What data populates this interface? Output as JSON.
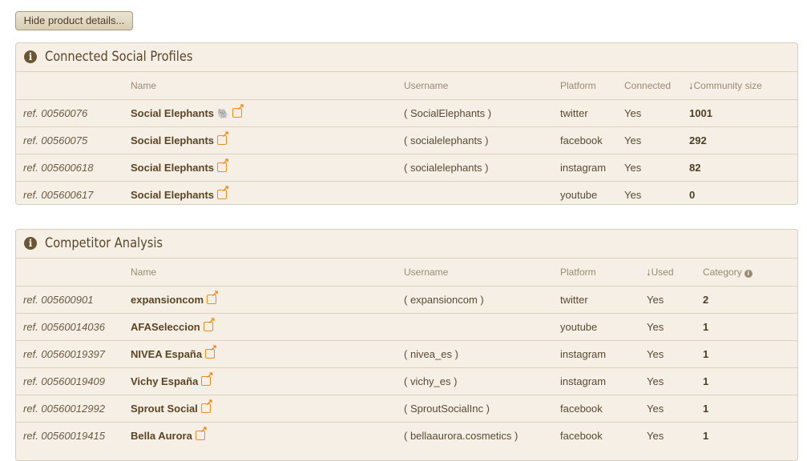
{
  "toggle_button": "Hide product details...",
  "social": {
    "title": "Connected Social Profiles",
    "headers": {
      "name": "Name",
      "username": "Username",
      "platform": "Platform",
      "connected": "Connected",
      "community": "Community size"
    },
    "sort_arrow": "↓",
    "rows": [
      {
        "ref": "ref. 00560076",
        "name": "Social Elephants",
        "emoji": "🐘",
        "username": "( SocialElephants )",
        "platform": "twitter",
        "connected": "Yes",
        "size": "1001"
      },
      {
        "ref": "ref. 00560075",
        "name": "Social Elephants",
        "emoji": "",
        "username": "( socialelephants )",
        "platform": "facebook",
        "connected": "Yes",
        "size": "292"
      },
      {
        "ref": "ref. 005600618",
        "name": "Social Elephants",
        "emoji": "",
        "username": "( socialelephants )",
        "platform": "instagram",
        "connected": "Yes",
        "size": "82"
      },
      {
        "ref": "ref. 005600617",
        "name": "Social Elephants",
        "emoji": "",
        "username": "",
        "platform": "youtube",
        "connected": "Yes",
        "size": "0"
      }
    ]
  },
  "competitor": {
    "title": "Competitor Analysis",
    "headers": {
      "name": "Name",
      "username": "Username",
      "platform": "Platform",
      "used": "Used",
      "category": "Category"
    },
    "sort_arrow": "↓",
    "rows": [
      {
        "ref": "ref. 005600901",
        "name": "expansioncom",
        "username": "( expansioncom )",
        "platform": "twitter",
        "used": "Yes",
        "category": "2"
      },
      {
        "ref": "ref. 00560014036",
        "name": "AFASeleccion",
        "username": "",
        "platform": "youtube",
        "used": "Yes",
        "category": "1"
      },
      {
        "ref": "ref. 00560019397",
        "name": "NIVEA España",
        "username": "( nivea_es )",
        "platform": "instagram",
        "used": "Yes",
        "category": "1"
      },
      {
        "ref": "ref. 00560019409",
        "name": "Vichy España",
        "username": "( vichy_es )",
        "platform": "instagram",
        "used": "Yes",
        "category": "1"
      },
      {
        "ref": "ref. 00560012992",
        "name": "Sprout Social",
        "username": "( SproutSocialInc )",
        "platform": "facebook",
        "used": "Yes",
        "category": "1"
      },
      {
        "ref": "ref. 00560019415",
        "name": "Bella Aurora",
        "username": "( bellaaurora.cosmetics )",
        "platform": "facebook",
        "used": "Yes",
        "category": "1"
      }
    ]
  }
}
